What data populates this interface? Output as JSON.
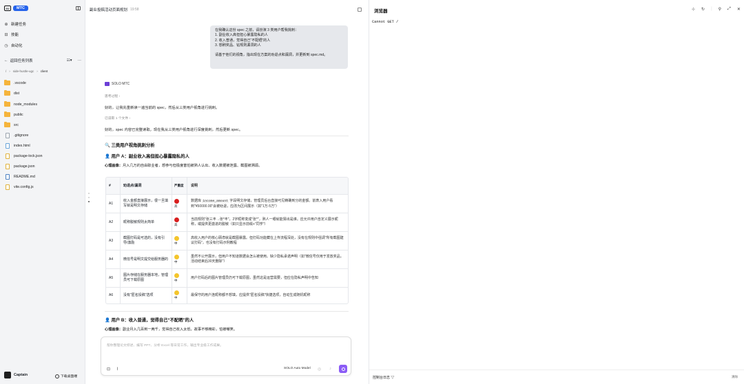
{
  "sidebar": {
    "logo_mark": "SV",
    "brand": "MTC",
    "nav": [
      {
        "label": "新建任务",
        "icon": "plus-circle-icon"
      },
      {
        "label": "技能",
        "icon": "book-icon"
      },
      {
        "label": "自动化",
        "icon": "clock-icon"
      }
    ],
    "back_label": "返回任务列表",
    "more": "···",
    "breadcrumb": [
      "/",
      "side-hustle-ugc",
      "client"
    ],
    "files": [
      {
        "name": ".vscode",
        "type": "folder"
      },
      {
        "name": "dist",
        "type": "folder"
      },
      {
        "name": "node_modules",
        "type": "folder"
      },
      {
        "name": "public",
        "type": "folder"
      },
      {
        "name": "src",
        "type": "folder"
      },
      {
        "name": ".gitignore",
        "type": "file"
      },
      {
        "name": "index.html",
        "type": "html"
      },
      {
        "name": "package-lock.json",
        "type": "json"
      },
      {
        "name": "package.json",
        "type": "json"
      },
      {
        "name": "README.md",
        "type": "md"
      },
      {
        "name": "vite.config.js",
        "type": "js"
      }
    ],
    "user_name": "Captain",
    "download_label": "下载桌面端"
  },
  "chat": {
    "title": "副业投稿活动页面规划",
    "time": "19:58",
    "user_message": [
      "在我确认这份 spec 之前，请扮演 3 类用户帮我挑刺：",
      "1. 副业收入高但担心暴露隐私的人",
      "2. 收入普通，觉得自己“不配晒”的人",
      "3. 想刷奖品、钻规则漏洞的人",
      "",
      "请基于他们的视角，指出现在方案的劝退点和漏洞，并更新到 spec.md。"
    ],
    "agent_name": "SOLO MTC",
    "thinking_label": "思考过程 ›",
    "para1": "好的，让我先重新读一遍当前的 spec，然后从三类用户视角进行挑刺。",
    "read_label": "已读取 1 个文件 ›",
    "para2": "好的，spec 内容已完整读取。现在我从三类用户视角进行深度挑刺，然后更新 spec。",
    "section_title": "🔍 三类用户视角挑刺分析",
    "userA_title": "👤 用户 A：副业收入高但担心暴露隐私的人",
    "userA_label": "心理画像：",
    "userA_desc": "月入几万的自由职业者，想参与但极度害怕被熟人认出、收入数据被泄露、截图被溯源。",
    "table_headers": [
      "#",
      "劝退点/漏洞",
      "严重度",
      "说明"
    ],
    "table_rows": [
      {
        "id": "A1",
        "point": "收入金额直接展示，很一旦填写就是明文存储",
        "severity": "高",
        "level": "red",
        "desc_pre": "数据库 ",
        "code": "income_amount",
        "desc_post": " 字段明文存储，管理员后台直接可见精确到分的金额。前表入用户看到\"¥50000.00\"会被劝退，应改为区间展示（如\"1万-5万\"）"
      },
      {
        "id": "A2",
        "point": "昵称脱敏规则太简单",
        "severity": "高",
        "level": "red",
        "desc_pre": "当前规则\"张三丰→张*丰\"，2字昵称变成\"张*\"，熟人一眼就能猜出是谁。应允许用户自定义展示昵称，或提供更激进的脱敏（如只显示前缀+\"同学\"）",
        "code": "",
        "desc_post": ""
      },
      {
        "id": "A3",
        "point": "截图打码是可选的，没有引导/激励",
        "severity": "中",
        "level": "yel",
        "desc_pre": "高收入用户的核心顾虑就是截图暴露。但打码功能藏在上传流程深处，没有在规则中强调\"所有截图建议打码\"，也没有打码示例教程",
        "code": "",
        "desc_post": ""
      },
      {
        "id": "A4",
        "point": "微信号是明文提交给服务器的",
        "severity": "中",
        "level": "yel",
        "desc_pre": "虽然不公开展示，但用户不知道数据会怎么被使用。缺少隐私承诺声明（如\"微信号仅用于发放奖品，活动结束后30天删除\"）",
        "code": "",
        "desc_post": ""
      },
      {
        "id": "A5",
        "point": "图片存储在服务器本地，管理员可下载原图",
        "severity": "中",
        "level": "yel",
        "desc_pre": "用户打码后的图片管理员仍可下载原图，虽然这是运营需要，但应在隐私声明中告知",
        "code": "",
        "desc_post": ""
      },
      {
        "id": "A6",
        "point": "没有\"匿名投稿\"选项",
        "severity": "中",
        "level": "yel",
        "desc_pre": "最保守的用户连昵称都不想填，应提供\"匿名投稿\"快捷选项，自动生成随机昵称",
        "code": "",
        "desc_post": ""
      }
    ],
    "userB_title": "👤 用户 B：收入普通，觉得自己“不配晒”的人",
    "userB_label": "心理画像：",
    "userB_desc": "副业月入几百到一两千，觉得自己收入太低，故事不够精彩，怕被嘲笑。",
    "composer_placeholder": "帮你整理论文综述、编写 PPT、分析 Excel 等日常工作，输出专业级工作成果。",
    "model_label": "SOLO Auto Model"
  },
  "browser": {
    "title": "浏览器",
    "content": "Cannot GET /",
    "footer_label": "控制台日志",
    "footer_right": "清除"
  }
}
